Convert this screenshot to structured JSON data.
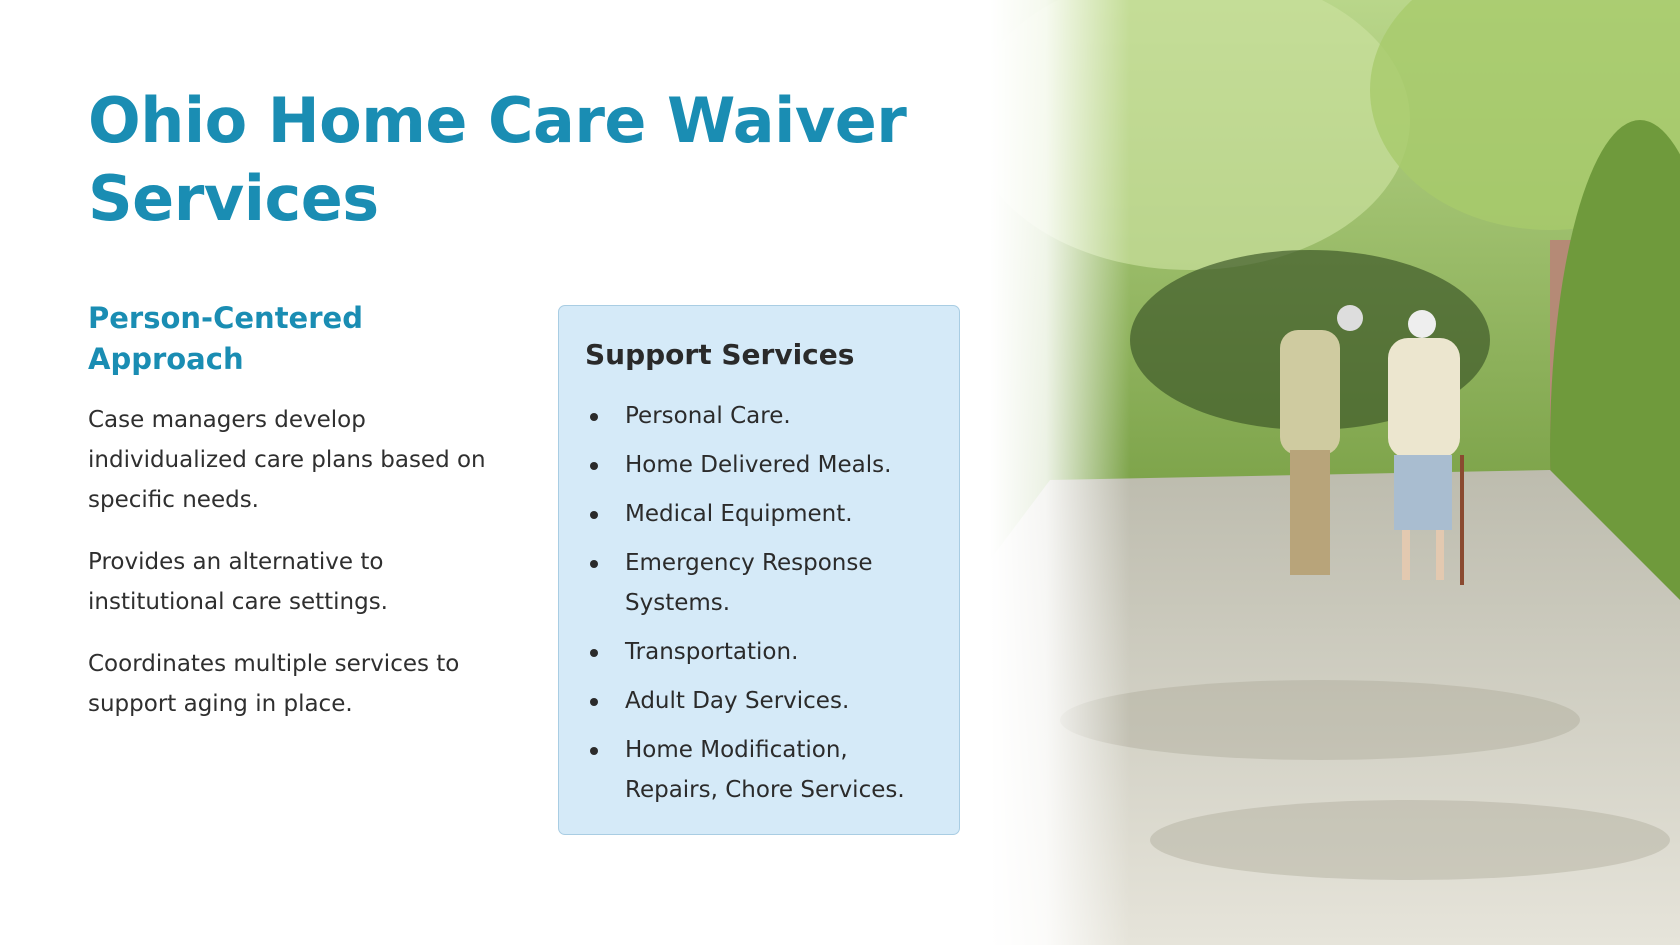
{
  "title": "Ohio Home Care Waiver Services",
  "left": {
    "heading": "Person-Centered Approach",
    "paragraphs": [
      "Case managers develop individualized care plans based on specific needs.",
      "Provides an alternative to institutional care settings.",
      "Coordinates multiple services to support aging in place."
    ]
  },
  "support": {
    "heading": "Support Services",
    "items": [
      "Personal Care.",
      "Home Delivered Meals.",
      "Medical Equipment.",
      "Emergency Response Systems.",
      "Transportation.",
      "Adult Day Services.",
      "Home Modification, Repairs, Chore Services."
    ]
  },
  "colors": {
    "accent": "#1a8db3",
    "box_bg": "#d5eaf8",
    "box_border": "#a9cde3"
  }
}
